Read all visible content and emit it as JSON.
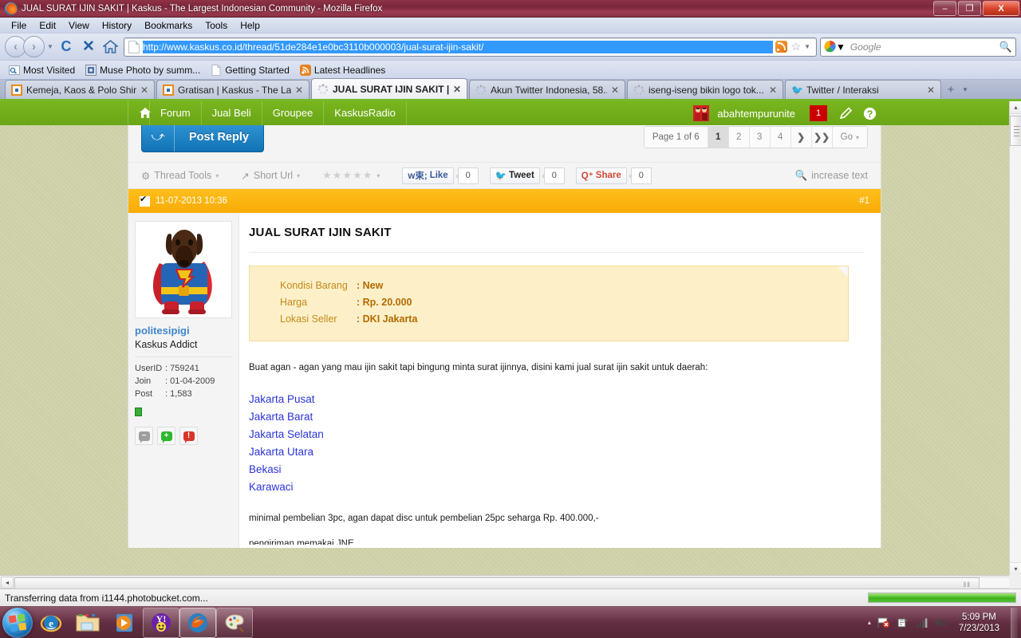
{
  "window": {
    "title": "JUAL SURAT IJIN SAKIT | Kaskus - The Largest Indonesian Community - Mozilla Firefox",
    "icon": "firefox-icon",
    "minimize_label": "–",
    "maximize_label": "❐",
    "close_label": "X"
  },
  "menubar": {
    "items": [
      {
        "label": "File"
      },
      {
        "label": "Edit"
      },
      {
        "label": "View"
      },
      {
        "label": "History"
      },
      {
        "label": "Bookmarks"
      },
      {
        "label": "Tools"
      },
      {
        "label": "Help"
      }
    ]
  },
  "toolbar": {
    "back_label": "‹",
    "forward_label": "›",
    "reload_label": "C",
    "stop_label": "✕",
    "home_label": "home-icon",
    "url": "http://www.kaskus.co.id/thread/51de284e1e0bc3110b000003/jual-surat-ijin-sakit/",
    "rss_title": "Subscribe to this page",
    "bookmark_star": "☆",
    "dropdown_caret": "▼",
    "search_engine": "Google",
    "search_placeholder": "Google",
    "search_icon": "magnifier-icon"
  },
  "bookmarks": [
    {
      "label": "Most Visited",
      "icon": "most-visited-icon"
    },
    {
      "label": "Muse Photo by summ...",
      "icon": "bookmark-icon"
    },
    {
      "label": "Getting Started",
      "icon": "page-icon"
    },
    {
      "label": "Latest Headlines",
      "icon": "rss-icon"
    }
  ],
  "tabs": [
    {
      "label": "Kemeja, Kaos & Polo Shirt ...",
      "favicon": "kaskus-favicon",
      "active": false,
      "close": "✕"
    },
    {
      "label": "Gratisan | Kaskus - The Lar...",
      "favicon": "kaskus-favicon",
      "active": false,
      "close": "✕"
    },
    {
      "label": "JUAL SURAT IJIN SAKIT |...",
      "favicon": "loading-spinner",
      "active": true,
      "close": "✕"
    },
    {
      "label": "Akun Twitter Indonesia, 58....",
      "favicon": "loading-spinner",
      "active": false,
      "close": "✕"
    },
    {
      "label": "iseng-iseng bikin logo tok...",
      "favicon": "loading-spinner",
      "active": false,
      "close": "✕"
    },
    {
      "label": "Twitter / Interaksi",
      "favicon": "twitter-favicon",
      "active": false,
      "close": "✕"
    }
  ],
  "tabstrip": {
    "new_tab_label": "+",
    "list_all_label": "▾"
  },
  "site_nav": {
    "home_icon": "home-icon",
    "items": [
      {
        "label": "Forum"
      },
      {
        "label": "Jual Beli"
      },
      {
        "label": "Groupee"
      },
      {
        "label": "KaskusRadio"
      }
    ],
    "username": "abahtempurunite",
    "notification_count": "1",
    "compose_icon": "pencil-icon",
    "help_icon": "question-icon",
    "accent_green": "#79b51d",
    "badge_red": "#cc0000"
  },
  "thread": {
    "post_reply_label": "Post Reply",
    "post_reply_icon": "reply-arrow-icon",
    "pager": {
      "page_label": "Page 1 of 6",
      "pages": [
        "1",
        "2",
        "3",
        "4"
      ],
      "current": "1",
      "next_label": "❯",
      "last_label": "❯❯",
      "go_label": "Go",
      "go_caret": "▾"
    },
    "tools": [
      {
        "label": "Thread Tools",
        "icon": "gear-icon",
        "caret": "▾"
      },
      {
        "label": "Short Url",
        "icon": "share-box-icon",
        "caret": "▾"
      }
    ],
    "rating": {
      "stars": "★★★★★",
      "caret": "▾"
    },
    "social": [
      {
        "name": "facebook",
        "label": "Like",
        "icon": "facebook-icon",
        "count": "0"
      },
      {
        "name": "twitter",
        "label": "Tweet",
        "icon": "twitter-icon",
        "count": "0"
      },
      {
        "name": "googleplus",
        "label": "Share",
        "icon": "googleplus-icon",
        "count": "0"
      }
    ],
    "increase_text_label": "increase text",
    "increase_text_icon": "magnifier-icon",
    "post": {
      "timestamp": "11-07-2013 10:36",
      "post_number": "#1",
      "checkbox_icon": "checked-box-icon",
      "title": "JUAL SURAT IJIN SAKIT",
      "author": {
        "username": "politesipigi",
        "rank": "Kaskus Addict",
        "avatar_alt": "dog in superman costume",
        "stats": [
          {
            "key": "UserID",
            "value": ": 759241"
          },
          {
            "key": "Join",
            "value": ": 01-04-2009"
          },
          {
            "key": "Post",
            "value": ": 1,583"
          }
        ],
        "online_status": "online",
        "actions": [
          {
            "name": "neutral-reputation-button",
            "icon": "grey-bubble-icon",
            "glyph": "−"
          },
          {
            "name": "give-reputation-button",
            "icon": "green-bubble-icon",
            "glyph": "+"
          },
          {
            "name": "report-post-button",
            "icon": "red-bubble-icon",
            "glyph": "!"
          }
        ]
      },
      "info_box": [
        {
          "key": "Kondisi Barang",
          "value": ": New"
        },
        {
          "key": "Harga",
          "value": ": Rp. 20.000"
        },
        {
          "key": "Lokasi Seller",
          "value": ": DKI Jakarta"
        }
      ],
      "intro": "Buat agan - agan yang mau ijin sakit tapi bingung minta surat ijinnya, disini kami jual surat ijin sakit untuk daerah:",
      "cities": [
        "Jakarta Pusat",
        "Jakarta Barat",
        "Jakarta Selatan",
        "Jakarta Utara",
        "Bekasi",
        "Karawaci"
      ],
      "note": "minimal pembelian 3pc, agan dapat disc untuk pembelian 25pc seharga Rp. 400.000,-",
      "clipped_line": "pengiriman memakai JNE"
    }
  },
  "scrollbars": {
    "h_left_arrow": "◂",
    "h_right_grip": "‖‖",
    "v_up_arrow": "▴",
    "v_down_arrow": "▾"
  },
  "statusbar": {
    "text": "Transferring data from i1144.photobucket.com...",
    "progress_percent": "100"
  },
  "taskbar": {
    "start_label": "start-orb",
    "items": [
      {
        "name": "internet-explorer-icon",
        "state": "pinned"
      },
      {
        "name": "windows-explorer-icon",
        "state": "pinned"
      },
      {
        "name": "windows-media-player-icon",
        "state": "pinned"
      },
      {
        "name": "yahoo-messenger-icon",
        "state": "open"
      },
      {
        "name": "firefox-icon",
        "state": "active"
      },
      {
        "name": "paint-icon",
        "state": "open"
      }
    ],
    "tray": {
      "caret": "▴",
      "icons": [
        "network-flag-icon",
        "action-center-icon",
        "signal-icon",
        "volume-icon"
      ],
      "time": "5:09 PM",
      "date": "7/23/2013"
    }
  }
}
